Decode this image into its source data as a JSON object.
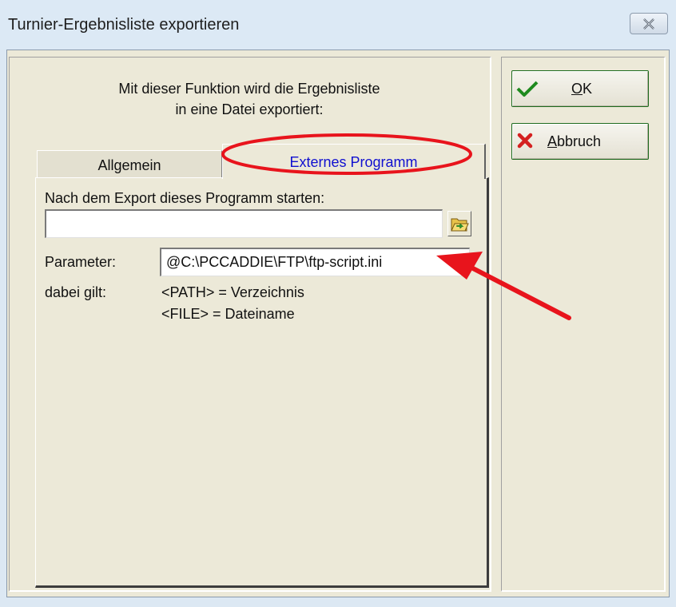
{
  "window": {
    "title": "Turnier-Ergebnisliste exportieren",
    "close_icon": "close-x-icon"
  },
  "intro": {
    "line1": "Mit dieser Funktion wird die Ergebnisliste",
    "line2": "in eine Datei exportiert:"
  },
  "tabs": [
    {
      "label": "Allgemein",
      "active": false
    },
    {
      "label": "Externes Programm",
      "active": true
    }
  ],
  "external": {
    "run_program_label": "Nach dem Export dieses Programm starten:",
    "program_path_value": "",
    "browse_icon": "folder-open-icon",
    "parameter_label": "Parameter:",
    "parameter_value": "@C:\\PCCADDIE\\FTP\\ftp-script.ini",
    "legend_label": "dabei gilt:",
    "legend_path": "<PATH> = Verzeichnis",
    "legend_file": "<FILE> = Dateiname"
  },
  "buttons": {
    "ok": {
      "mnemonic": "O",
      "rest": "K",
      "icon": "checkmark-icon"
    },
    "cancel": {
      "mnemonic": "A",
      "rest": "bbruch",
      "icon": "red-x-icon"
    }
  },
  "colors": {
    "annotation": "#e8141c",
    "active_tab_text": "#1010d0",
    "dialog_bg": "#ece9d8"
  }
}
